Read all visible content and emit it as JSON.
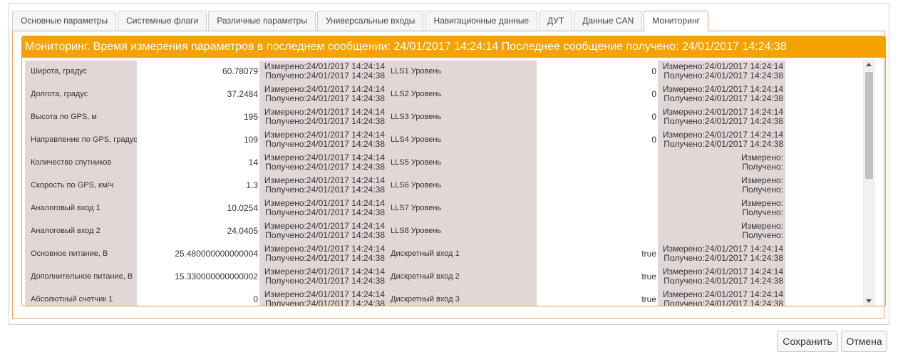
{
  "tabs": [
    {
      "label": "Основные параметры"
    },
    {
      "label": "Системные флаги"
    },
    {
      "label": "Различные параметры"
    },
    {
      "label": "Универсальные входы"
    },
    {
      "label": "Навигационные данные"
    },
    {
      "label": "ДУТ"
    },
    {
      "label": "Данные CAN"
    },
    {
      "label": "Мониторинг"
    }
  ],
  "active_tab": "Мониторинг",
  "monitor": {
    "header": "Мониторинг. Время измерения параметров в последнем сообщении: 24/01/2017 14:24:14 Последнее сообщение получено: 24/01/2017 14:24:38",
    "rows": [
      {
        "l_label": "Широта, градус",
        "l_value": "60.78079",
        "l_meas": "Измерено:24/01/2017 14:24:14",
        "l_recv": "Получено:24/01/2017 14:24:38",
        "r_label": "LLS1 Уровень",
        "r_value": "0",
        "r_meas": "Измерено:24/01/2017 14:24:14",
        "r_recv": "Получено:24/01/2017 14:24:38"
      },
      {
        "l_label": "Долгота, градус",
        "l_value": "37.2484",
        "l_meas": "Измерено:24/01/2017 14:24:14",
        "l_recv": "Получено:24/01/2017 14:24:38",
        "r_label": "LLS2 Уровень",
        "r_value": "0",
        "r_meas": "Измерено:24/01/2017 14:24:14",
        "r_recv": "Получено:24/01/2017 14:24:38"
      },
      {
        "l_label": "Высота по GPS, м",
        "l_value": "195",
        "l_meas": "Измерено:24/01/2017 14:24:14",
        "l_recv": "Получено:24/01/2017 14:24:38",
        "r_label": "LLS3 Уровень",
        "r_value": "0",
        "r_meas": "Измерено:24/01/2017 14:24:14",
        "r_recv": "Получено:24/01/2017 14:24:38"
      },
      {
        "l_label": "Направление по GPS, градус",
        "l_value": "109",
        "l_meas": "Измерено:24/01/2017 14:24:14",
        "l_recv": "Получено:24/01/2017 14:24:38",
        "r_label": "LLS4 Уровень",
        "r_value": "0",
        "r_meas": "Измерено:24/01/2017 14:24:14",
        "r_recv": "Получено:24/01/2017 14:24:38"
      },
      {
        "l_label": "Количество спутников",
        "l_value": "14",
        "l_meas": "Измерено:24/01/2017 14:24:14",
        "l_recv": "Получено:24/01/2017 14:24:38",
        "r_label": "LLS5 Уровень",
        "r_value": "",
        "r_meas": "Измерено:",
        "r_recv": "Получено:"
      },
      {
        "l_label": "Скорость по GPS, км/ч",
        "l_value": "1.3",
        "l_meas": "Измерено:24/01/2017 14:24:14",
        "l_recv": "Получено:24/01/2017 14:24:38",
        "r_label": "LLS6 Уровень",
        "r_value": "",
        "r_meas": "Измерено:",
        "r_recv": "Получено:"
      },
      {
        "l_label": "Аналоговый вход 1",
        "l_value": "10.0254",
        "l_meas": "Измерено:24/01/2017 14:24:14",
        "l_recv": "Получено:24/01/2017 14:24:38",
        "r_label": "LLS7 Уровень",
        "r_value": "",
        "r_meas": "Измерено:",
        "r_recv": "Получено:"
      },
      {
        "l_label": "Аналоговый вход 2",
        "l_value": "24.0405",
        "l_meas": "Измерено:24/01/2017 14:24:14",
        "l_recv": "Получено:24/01/2017 14:24:38",
        "r_label": "LLS8 Уровень",
        "r_value": "",
        "r_meas": "Измерено:",
        "r_recv": "Получено:"
      },
      {
        "l_label": "Основное питание, В",
        "l_value": "25.480000000000004",
        "l_meas": "Измерено:24/01/2017 14:24:14",
        "l_recv": "Получено:24/01/2017 14:24:38",
        "r_label": "Дискретный вход 1",
        "r_value": "true",
        "r_meas": "Измерено:24/01/2017 14:24:14",
        "r_recv": "Получено:24/01/2017 14:24:38"
      },
      {
        "l_label": "Дополнительное питание, В",
        "l_value": "15.330000000000002",
        "l_meas": "Измерено:24/01/2017 14:24:14",
        "l_recv": "Получено:24/01/2017 14:24:38",
        "r_label": "Дискретный вход 2",
        "r_value": "true",
        "r_meas": "Измерено:24/01/2017 14:24:14",
        "r_recv": "Получено:24/01/2017 14:24:38"
      },
      {
        "l_label": "Абсолютный счетчик 1",
        "l_value": "0",
        "l_meas": "Измерено:24/01/2017 14:24:14",
        "l_recv": "Получено:24/01/2017 14:24:38",
        "r_label": "Дискретный вход 3",
        "r_value": "true",
        "r_meas": "Измерено:24/01/2017 14:24:14",
        "r_recv": "Получено:24/01/2017 14:24:38"
      }
    ]
  },
  "buttons": {
    "save": "Сохранить",
    "cancel": "Отмена"
  },
  "colors": {
    "header_bg": "#f5a100",
    "label_bg": "#e2d7d7",
    "panel_border": "#e6a574"
  }
}
